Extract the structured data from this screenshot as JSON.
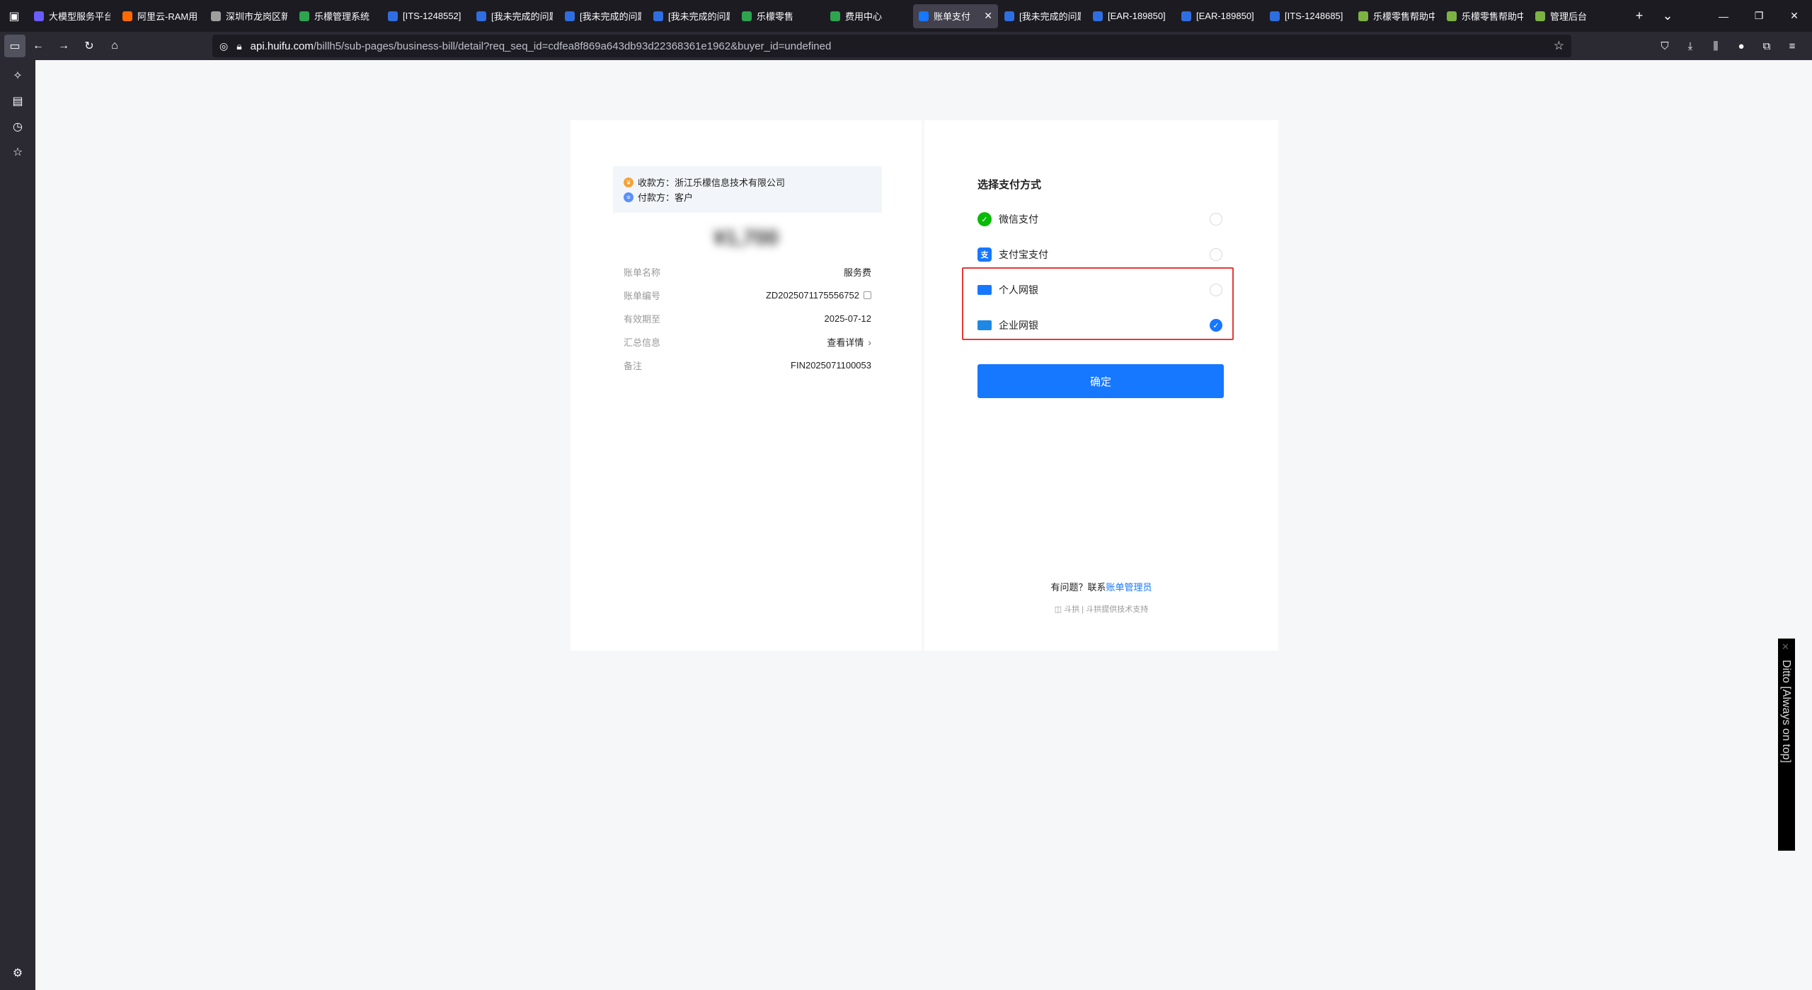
{
  "browser": {
    "tabs": [
      {
        "label": "大模型服务平台",
        "color": "#6a5cff"
      },
      {
        "label": "阿里云-RAM用",
        "color": "#ff6a00"
      },
      {
        "label": "深圳市龙岗区新",
        "color": "#9e9e9e"
      },
      {
        "label": "乐檬管理系统",
        "color": "#2ea44f"
      },
      {
        "label": "[ITS-1248552]",
        "color": "#2f6ee0"
      },
      {
        "label": "[我未完成的问题",
        "color": "#2f6ee0"
      },
      {
        "label": "[我未完成的问题",
        "color": "#2f6ee0"
      },
      {
        "label": "[我未完成的问题",
        "color": "#2f6ee0"
      },
      {
        "label": "乐檬零售",
        "color": "#2ea44f"
      },
      {
        "label": "费用中心",
        "color": "#2ea44f"
      },
      {
        "label": "账单支付",
        "color": "#1677ff",
        "active": true
      },
      {
        "label": "[我未完成的问题",
        "color": "#2f6ee0"
      },
      {
        "label": "[EAR-189850]",
        "color": "#2f6ee0"
      },
      {
        "label": "[EAR-189850]",
        "color": "#2f6ee0"
      },
      {
        "label": "[ITS-1248685]",
        "color": "#2f6ee0"
      },
      {
        "label": "乐檬零售帮助中",
        "color": "#7cb342"
      },
      {
        "label": "乐檬零售帮助中",
        "color": "#7cb342"
      },
      {
        "label": "管理后台",
        "color": "#7cb342"
      }
    ],
    "url_host": "api.huifu.com",
    "url_rest": "/billh5/sub-pages/business-bill/detail?req_seq_id=cdfea8f869a643db93d22368361e1962&buyer_id=undefined"
  },
  "bill": {
    "payee_label": "收款方：",
    "payee": "浙江乐檬信息技术有限公司",
    "payer_label": "付款方：",
    "payer": "客户",
    "amount": "¥1,700",
    "rows": [
      {
        "key": "账单名称",
        "value": "服务费"
      },
      {
        "key": "账单编号",
        "value": "ZD2025071175556752"
      },
      {
        "key": "有效期至",
        "value": "2025-07-12"
      },
      {
        "key": "汇总信息",
        "value": "查看详情"
      },
      {
        "key": "备注",
        "value": "FIN2025071100053"
      }
    ]
  },
  "payment": {
    "title": "选择支付方式",
    "methods": [
      {
        "label": "微信支付",
        "icon": "wechat-icon",
        "checked": false
      },
      {
        "label": "支付宝支付",
        "icon": "alipay-icon",
        "checked": false
      },
      {
        "label": "个人网银",
        "icon": "bank-card-icon",
        "checked": false
      },
      {
        "label": "企业网银",
        "icon": "corporate-bank-icon",
        "checked": true
      }
    ],
    "confirm": "确定",
    "help_prefix": "有问题？联系",
    "help_link": "账单管理员",
    "powered": "斗拱提供技术支持",
    "powered_brand": "斗拱"
  },
  "ditto": {
    "label": "Ditto [Always on top]"
  }
}
